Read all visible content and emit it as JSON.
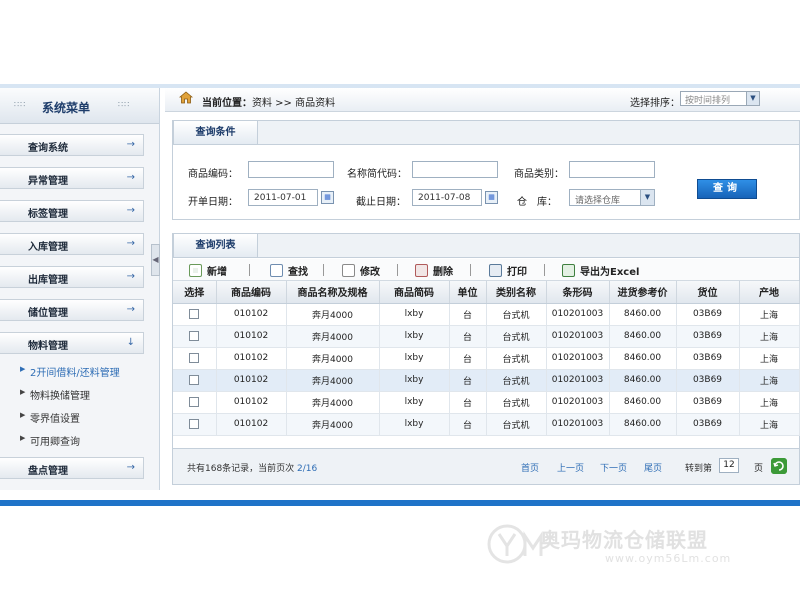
{
  "sidebar": {
    "title": "系统菜单",
    "menus": [
      {
        "label": "查询系统"
      },
      {
        "label": "异常管理"
      },
      {
        "label": "标签管理"
      },
      {
        "label": "入库管理"
      },
      {
        "label": "出库管理"
      },
      {
        "label": "储位管理"
      },
      {
        "label": "物料管理",
        "expanded": true
      }
    ],
    "sub_items": [
      {
        "label": "2开间借料/还料管理",
        "active": true
      },
      {
        "label": "物料换储管理"
      },
      {
        "label": "零界值设置"
      },
      {
        "label": "可用卿查询"
      }
    ],
    "last_menu": {
      "label": "盘点管理"
    }
  },
  "breadcrumb": {
    "prefix": "当前位置：",
    "path": "资料 >> 商品资料"
  },
  "sort": {
    "label": "选择排序：",
    "value": "按时间排列"
  },
  "query": {
    "tab": "查询条件",
    "fields": {
      "product_code_label": "商品编码：",
      "product_code": "",
      "short_code_label": "名称简代码：",
      "short_code": "",
      "category_label": "商品类别：",
      "category": "",
      "start_date_label": "开单日期：",
      "start_date": "2011-07-01",
      "end_date_label": "截止日期：",
      "end_date": "2011-07-08",
      "warehouse_label": "仓　库：",
      "warehouse_placeholder": "请选择仓库"
    },
    "button": "查询"
  },
  "results": {
    "tab": "查询列表",
    "toolbar": {
      "add": "新增",
      "find": "查找",
      "edit": "修改",
      "delete": "删除",
      "print": "打印",
      "export": "导出为Excel"
    },
    "columns": [
      "选择",
      "商品编码",
      "商品名称及规格",
      "商品简码",
      "单位",
      "类别名称",
      "条形码",
      "进货参考价",
      "货位",
      "产地"
    ],
    "rows": [
      [
        "010102",
        "奔月4000",
        "lxby",
        "台",
        "台式机",
        "010201003",
        "8460.00",
        "03B69",
        "上海"
      ],
      [
        "010102",
        "奔月4000",
        "lxby",
        "台",
        "台式机",
        "010201003",
        "8460.00",
        "03B69",
        "上海"
      ],
      [
        "010102",
        "奔月4000",
        "lxby",
        "台",
        "台式机",
        "010201003",
        "8460.00",
        "03B69",
        "上海"
      ],
      [
        "010102",
        "奔月4000",
        "lxby",
        "台",
        "台式机",
        "010201003",
        "8460.00",
        "03B69",
        "上海"
      ],
      [
        "010102",
        "奔月4000",
        "lxby",
        "台",
        "台式机",
        "010201003",
        "8460.00",
        "03B69",
        "上海"
      ],
      [
        "010102",
        "奔月4000",
        "lxby",
        "台",
        "台式机",
        "010201003",
        "8460.00",
        "03B69",
        "上海"
      ]
    ],
    "selected_row": 3
  },
  "pager": {
    "summary": "共有168条记录，当前页次 ",
    "page_status": "2/16",
    "first": "首页",
    "prev": "上一页",
    "next": "下一页",
    "last": "尾页",
    "goto_label": "转到第",
    "goto_value": "12",
    "unit": "页"
  },
  "watermark": {
    "name": "奥玛物流仓储联盟",
    "url": "www.oym56Lm.com"
  }
}
